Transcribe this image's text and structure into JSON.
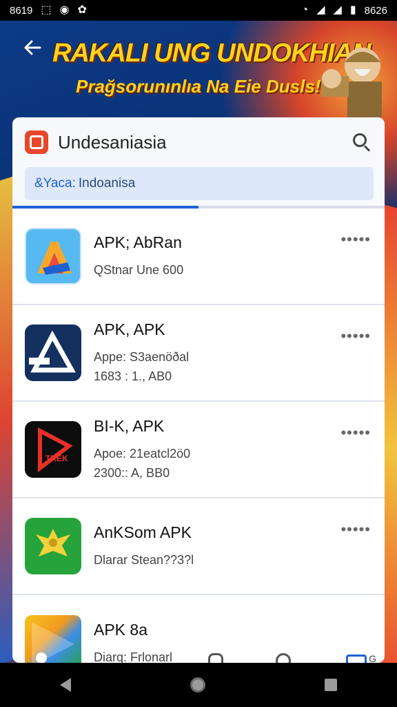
{
  "status_bar": {
    "time": "8619",
    "right_text": "8626"
  },
  "header": {
    "title": "RAKALI UNG UNDOKHIAN",
    "subtitle": "Prağsorunınlıa Na Eie Dusls!!"
  },
  "panel": {
    "title": "Undesaniasia",
    "filter_key": "&Yaca:",
    "filter_value": "Indoanisa",
    "progress_fraction": 0.5
  },
  "apps": [
    {
      "name": "APK; AbRan",
      "meta1": "QStnar Une 600",
      "meta2": ""
    },
    {
      "name": "APK, APK",
      "meta1": "Appe: S3aenöðal",
      "meta2": "1683 : 1., AB0"
    },
    {
      "name": "BI-K, APK",
      "meta1": "Apoe: 21eatcl2ö0",
      "meta2": "2300:: A, BB0"
    },
    {
      "name": "AnKSom APK",
      "meta1": "Dlarar Stean??3?l",
      "meta2": ""
    },
    {
      "name": "APK 8a",
      "meta1": "Diarq: Frlonarl",
      "meta2": ""
    }
  ],
  "more_label": "•••••",
  "update_badge": "G",
  "icons": {
    "back": "arrow-left-icon",
    "search": "search-icon",
    "more": "more-dots-icon"
  }
}
